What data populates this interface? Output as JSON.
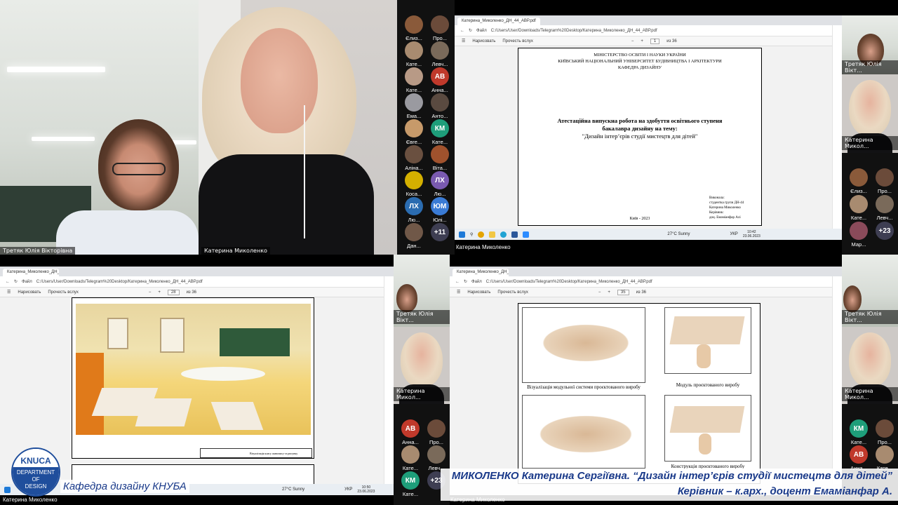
{
  "participants_top": [
    {
      "name": "Єлиз...",
      "initials": "",
      "color": "#8a5a3a"
    },
    {
      "name": "Про...",
      "initials": "",
      "color": "#6b4b3a"
    },
    {
      "name": "Кате...",
      "initials": "",
      "color": "#a88b70"
    },
    {
      "name": "Левч...",
      "initials": "",
      "color": "#7a6a5a"
    },
    {
      "name": "Кате...",
      "initials": "",
      "color": "#b89a86"
    },
    {
      "name": "Анна...",
      "initials": "АВ",
      "color": "#c0392b"
    },
    {
      "name": "Ема...",
      "initials": "",
      "color": "#9a9aa0"
    },
    {
      "name": "Анто...",
      "initials": "",
      "color": "#5a4a40"
    },
    {
      "name": "Євге...",
      "initials": "",
      "color": "#c79a6a"
    },
    {
      "name": "Кате...",
      "initials": "КМ",
      "color": "#1e9e7a"
    },
    {
      "name": "Аліна...",
      "initials": "",
      "color": "#6a5040"
    },
    {
      "name": "Віта...",
      "initials": "",
      "color": "#a0522d"
    },
    {
      "name": "Коса...",
      "initials": "",
      "color": "#d4b000"
    },
    {
      "name": "Лю...",
      "initials": "ЛХ",
      "color": "#7a5ab0"
    },
    {
      "name": "Лю...",
      "initials": "ЛХ",
      "color": "#2b6cb0"
    },
    {
      "name": "Юлі...",
      "initials": "ЮМ",
      "color": "#3a7bd5"
    },
    {
      "name": "Дан...",
      "initials": "",
      "color": "#705848"
    },
    {
      "name": "",
      "initials": "+11",
      "color": "#3e3e52"
    }
  ],
  "participants_right_top": [
    {
      "name": "Єлиз...",
      "initials": "",
      "color": "#8a5a3a"
    },
    {
      "name": "Про...",
      "initials": "",
      "color": "#6b4b3a"
    },
    {
      "name": "Кате...",
      "initials": "",
      "color": "#a88b70"
    },
    {
      "name": "Левч...",
      "initials": "",
      "color": "#7a6a5a"
    },
    {
      "name": "Мар...",
      "initials": "",
      "color": "#8a4a5a"
    },
    {
      "name": "",
      "initials": "+23",
      "color": "#3e3e52"
    }
  ],
  "participants_mid": [
    {
      "name": "Анна...",
      "initials": "АВ",
      "color": "#c0392b"
    },
    {
      "name": "Про...",
      "initials": "",
      "color": "#6b4b3a"
    },
    {
      "name": "Кате...",
      "initials": "",
      "color": "#a88b70"
    },
    {
      "name": "Левч...",
      "initials": "",
      "color": "#7a6a5a"
    },
    {
      "name": "Кате...",
      "initials": "КМ",
      "color": "#1e9e7a"
    },
    {
      "name": "",
      "initials": "+23",
      "color": "#3e3e52"
    }
  ],
  "participants_right_bottom": [
    {
      "name": "Кате...",
      "initials": "КМ",
      "color": "#1e9e7a"
    },
    {
      "name": "Про...",
      "initials": "",
      "color": "#6b4b3a"
    },
    {
      "name": "Анна...",
      "initials": "АВ",
      "color": "#c0392b"
    },
    {
      "name": "Кате...",
      "initials": "",
      "color": "#a88b70"
    }
  ],
  "cams": {
    "tretiak": "Третяк Юлія Вікторівна",
    "mykolenko": "Катерина Миколенко",
    "tretiak_short": "Третяк Юлія Вікт...",
    "mykolenko_short": "Катерина Микол..."
  },
  "browser": {
    "tab_title": "Катерина_Миколенко_ДН_44_АВР.pdf",
    "file_label": "Файл",
    "url": "C:/Users/User/Downloads/Telegram%20Desktop/Катерина_Миколенко_ДН_44_АВР.pdf",
    "draw_label": "Нарисовать",
    "read_label": "Прочесть вслух",
    "page_of": "из 36",
    "page_top": "1",
    "page_left": "28",
    "page_right": "35"
  },
  "title_page": {
    "ministry": "МІНІСТЕРСТВО ОСВІТИ І НАУКИ УКРАЇНИ",
    "university": "КИЇВСЬКИЙ НАЦІОНАЛЬНИЙ УНІВЕРСИТЕТ БУДІВНИЦТВА І АРХІТЕКТУРИ",
    "department": "КАФЕДРА ДИЗАЙНУ",
    "work_line1": "Атестаційна випускна робота на здобуття освітнього ступеня",
    "work_line2": "бакалавра дизайну на тему:",
    "work_topic": "\"Дизайн інтер’єрів студії мистецтв для дітей\"",
    "done_by": "Виконала:",
    "student_group": "студентка групи ДН-44",
    "student_name": "Катерина Миколенко",
    "supervisor_label": "Керівник:",
    "supervisor": "доц. Емаміанфар Алі",
    "city_year": "Київ - 2023"
  },
  "taskbar": {
    "weather": "27°C  Sunny",
    "lang": "УКР",
    "time_top": "10:42",
    "date": "23.06.2023",
    "time_left": "10:50",
    "time_right": "10:55"
  },
  "figures": {
    "cap1": "Візуалізація модульної системи проєктованого виробу",
    "cap2": "Модуль проєктованого виробу",
    "cap3": "Конструкція  проєктованого виробу",
    "drawing_title": "Візуалізація класу живопису та рисунку"
  },
  "logo": {
    "line1": "KNUCA",
    "line2": "DEPARTMENT",
    "line3": "OF",
    "line4": "DESIGN"
  },
  "footer": {
    "dept": "Кафедра дизайну КНУБА",
    "title_line": "МИКОЛЕНКО Катерина Сергіївна. “Дизайн інтер’єрів студії мистецтв для дітей”",
    "supervisor_line": "Керівник – к.арх., доцент Емаміанфар А.",
    "cam_label_left": "Катерина Миколенко",
    "cam_label_right": "Катерина Миколенко"
  },
  "colors": {
    "accent_blue": "#1a3a8a",
    "logo_blue": "#1f4e9c"
  }
}
